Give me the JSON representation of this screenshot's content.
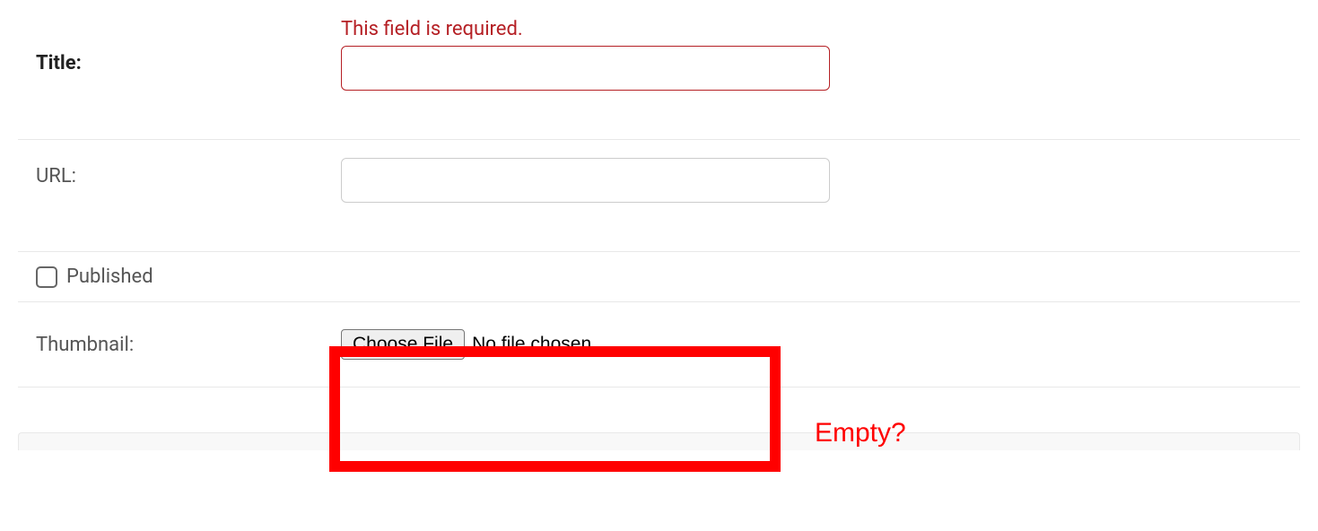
{
  "form": {
    "title": {
      "label": "Title:",
      "error": "This field is required.",
      "value": ""
    },
    "url": {
      "label": "URL:",
      "value": ""
    },
    "published": {
      "label": "Published",
      "checked": false
    },
    "thumbnail": {
      "label": "Thumbnail:",
      "button": "Choose File",
      "status": "No file chosen"
    }
  },
  "annotation": {
    "text": "Empty?"
  }
}
